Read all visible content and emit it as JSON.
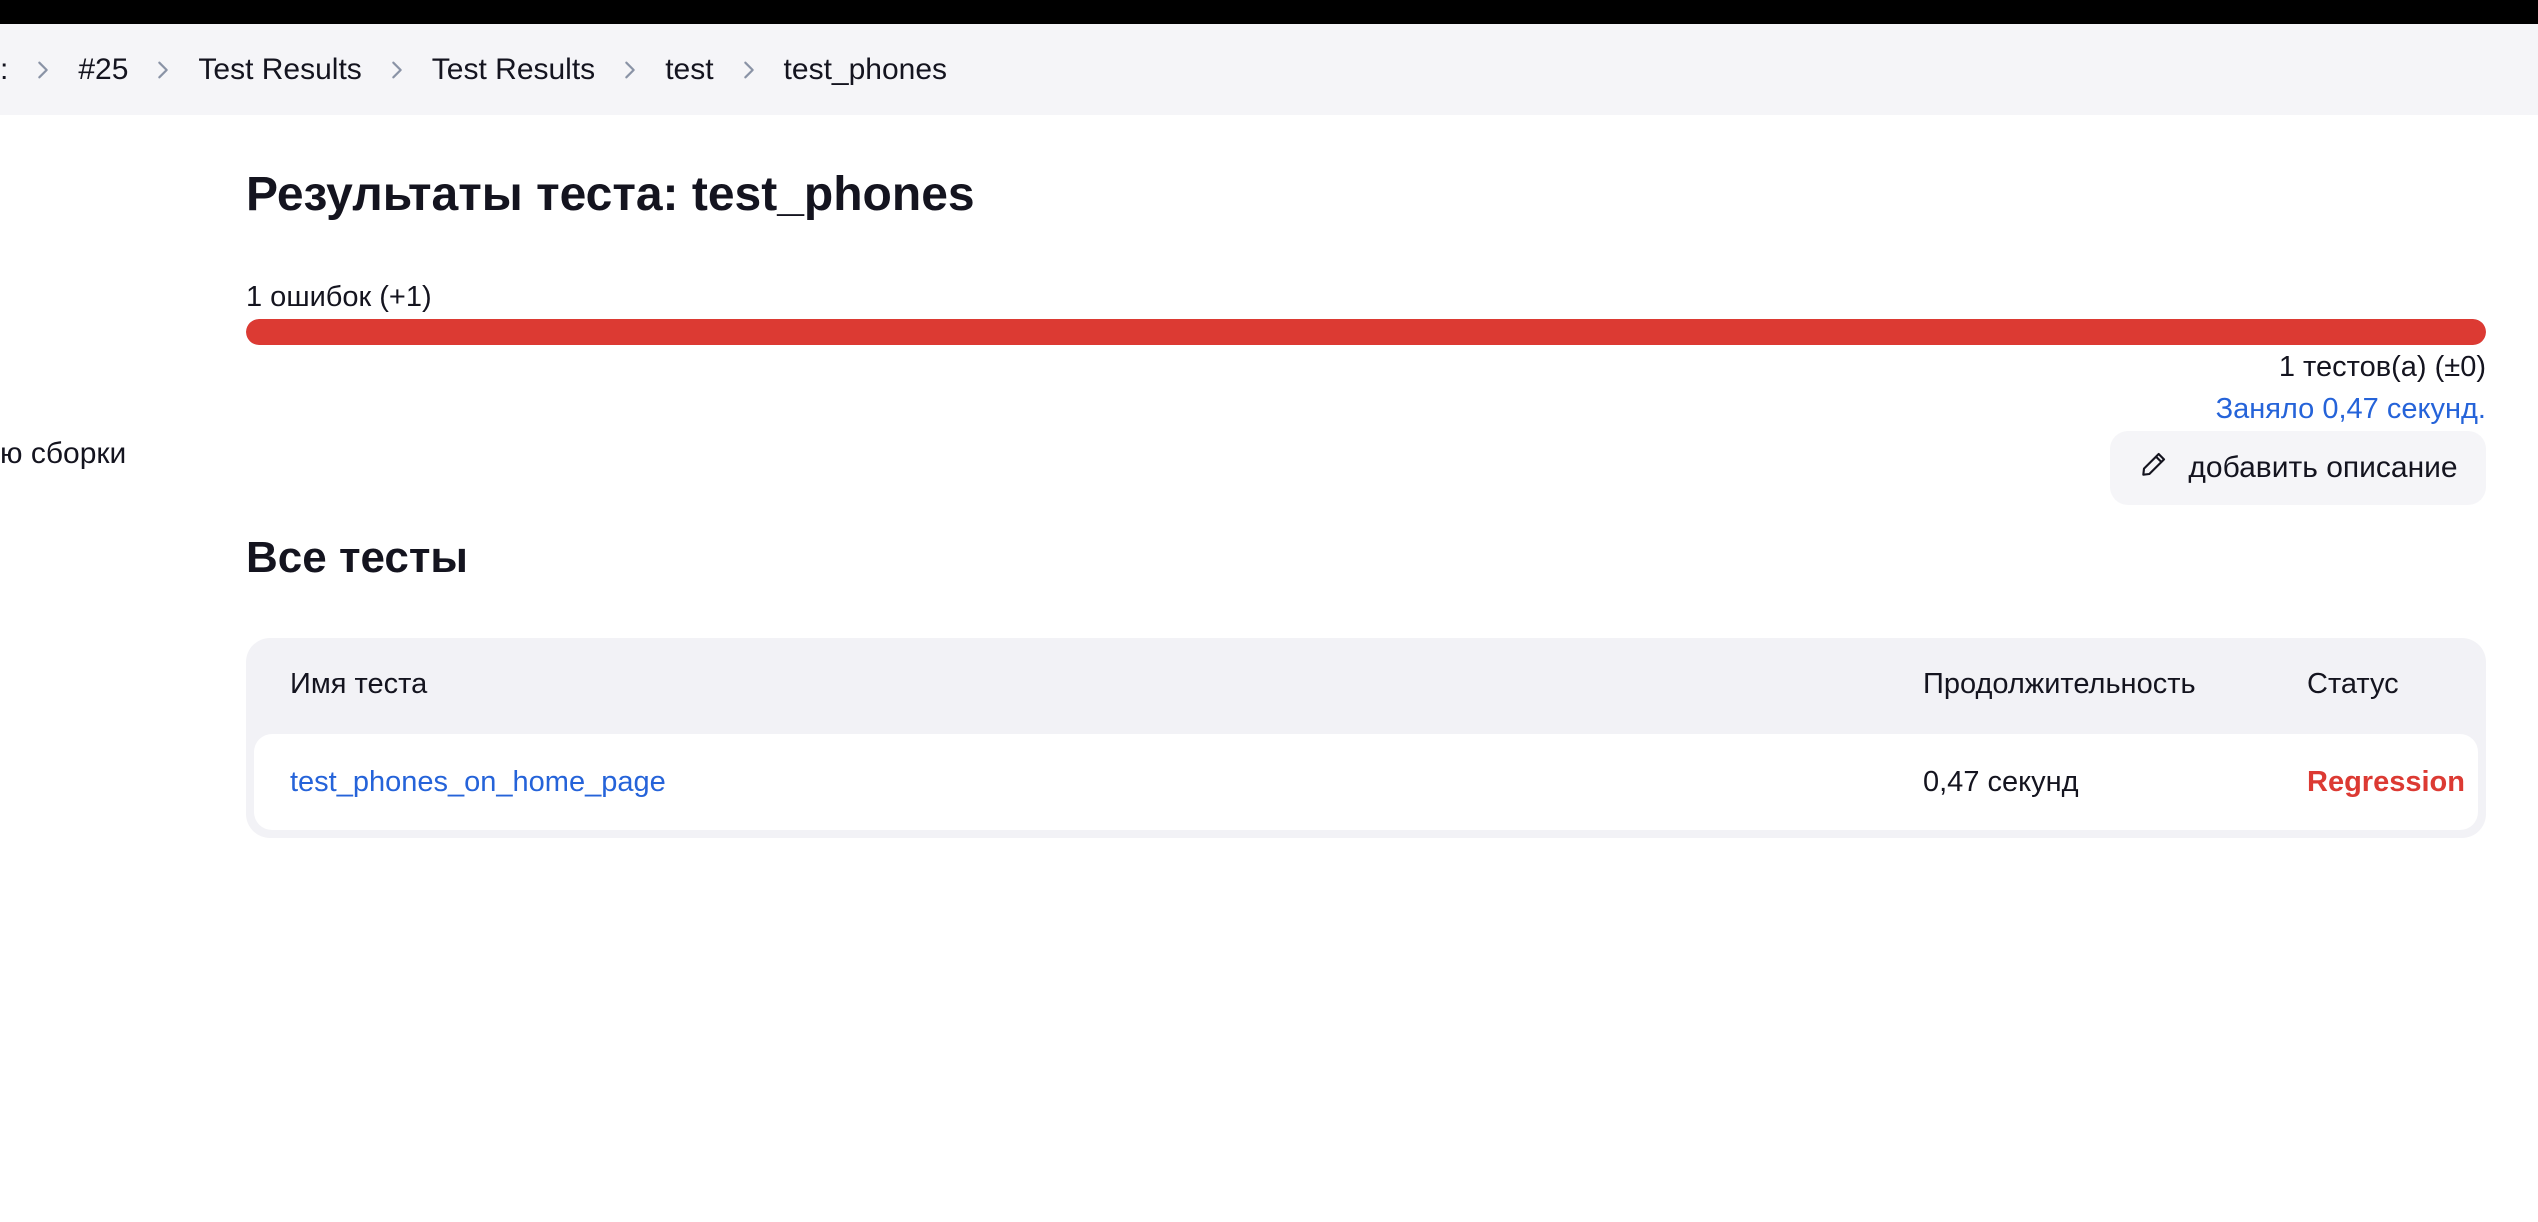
{
  "breadcrumbs": [
    {
      "label": ":"
    },
    {
      "label": "#25"
    },
    {
      "label": "Test Results"
    },
    {
      "label": "Test Results"
    },
    {
      "label": "test"
    },
    {
      "label": "test_phones"
    }
  ],
  "sidebar": {
    "partial_item_label": "ю сборки"
  },
  "main": {
    "title": "Результаты теста: test_phones",
    "fail_summary": "1 ошибок (+1)",
    "fail_fraction": 1.0,
    "tests_count": "1 тестов(а) (±0)",
    "duration_link": "Заняло 0,47 секунд.",
    "add_description_label": "добавить описание",
    "section_title": "Все тесты"
  },
  "table": {
    "headers": {
      "name": "Имя теста",
      "duration": "Продолжительность",
      "status": "Статус"
    },
    "rows": [
      {
        "name": "test_phones_on_home_page",
        "duration": "0,47 секунд",
        "status": "Regression"
      }
    ]
  },
  "colors": {
    "accent_link": "#2563d9",
    "failure_red": "#dc3a33",
    "breadcrumb_bg": "#f5f5f8"
  },
  "icons": {
    "breadcrumb_separator": "chevron-right-icon",
    "add_description": "pencil-icon"
  }
}
